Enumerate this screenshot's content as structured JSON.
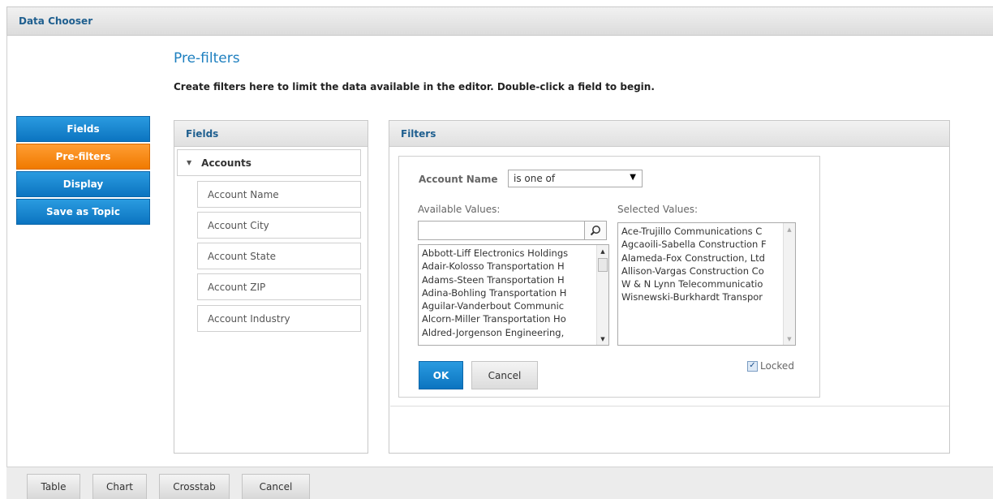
{
  "window": {
    "title": "Data Chooser"
  },
  "page": {
    "title": "Pre-filters",
    "description": "Create filters here to limit the data available in the editor. Double-click a field to begin."
  },
  "nav": {
    "items": [
      {
        "label": "Fields",
        "active": false
      },
      {
        "label": "Pre-filters",
        "active": true
      },
      {
        "label": "Display",
        "active": false
      },
      {
        "label": "Save as Topic",
        "active": false
      }
    ]
  },
  "fields_panel": {
    "title": "Fields",
    "root": {
      "label": "Accounts",
      "expanded": true
    },
    "items": [
      "Account Name",
      "Account City",
      "Account State",
      "Account ZIP",
      "Account Industry"
    ]
  },
  "filters_panel": {
    "title": "Filters",
    "field_label": "Account Name",
    "operator": "is one of",
    "available_label": "Available Values:",
    "selected_label": "Selected Values:",
    "search_value": "",
    "available_values": [
      "Abbott-Liff Electronics Holdings",
      "Adair-Kolosso Transportation H",
      "Adams-Steen Transportation H",
      "Adina-Bohling Transportation H",
      "Aguilar-Vanderbout Communic",
      "Alcorn-Miller Transportation Ho",
      "Aldred-Jorgenson Engineering,"
    ],
    "selected_values": [
      "Ace-Trujillo Communications C",
      "Agcaoili-Sabella Construction F",
      "Alameda-Fox Construction, Ltd",
      "Allison-Vargas Construction Co",
      "W & N Lynn Telecommunicatio",
      "Wisnewski-Burkhardt Transpor"
    ],
    "ok_label": "OK",
    "cancel_label": "Cancel",
    "locked_label": "Locked",
    "locked_checked": true
  },
  "bottom": {
    "buttons": [
      "Table",
      "Chart",
      "Crosstab",
      "Cancel"
    ]
  },
  "colors": {
    "accent_blue": "#0b74c0",
    "active_orange": "#f07a00",
    "title_blue": "#1d7fbf"
  }
}
